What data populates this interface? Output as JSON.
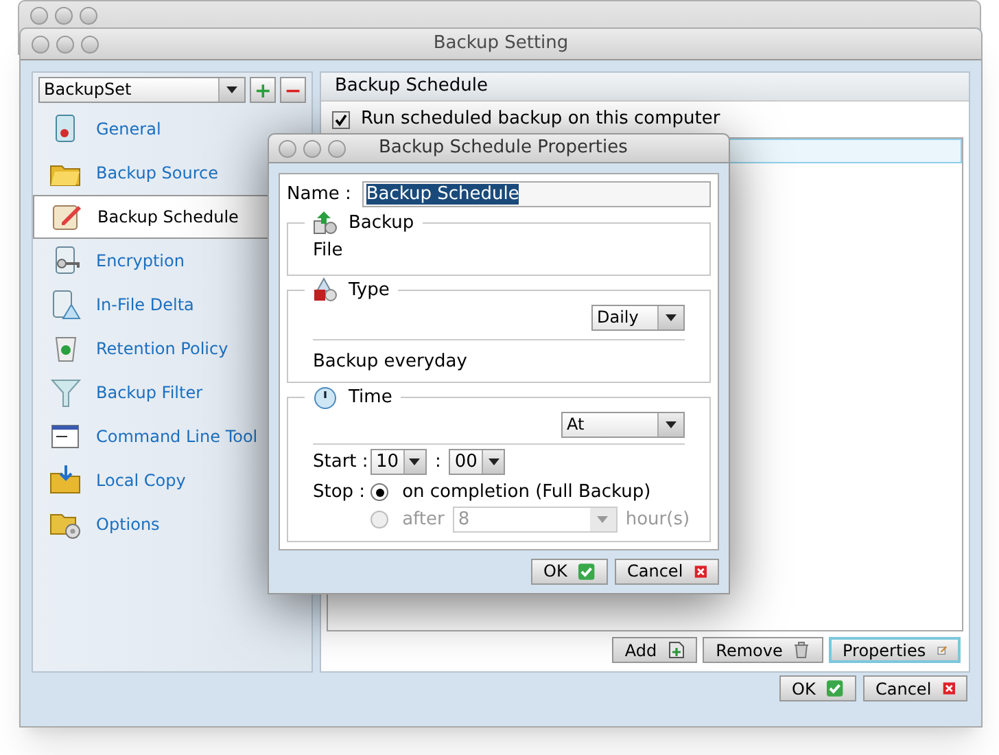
{
  "window": {
    "title": "Backup Setting"
  },
  "sidebar": {
    "backup_set": "BackupSet",
    "add": "+",
    "remove": "−",
    "items": [
      {
        "label": "General",
        "selected": false
      },
      {
        "label": "Backup Source",
        "selected": false
      },
      {
        "label": "Backup Schedule",
        "selected": true
      },
      {
        "label": "Encryption",
        "selected": false
      },
      {
        "label": "In-File Delta",
        "selected": false
      },
      {
        "label": "Retention Policy",
        "selected": false
      },
      {
        "label": "Backup Filter",
        "selected": false
      },
      {
        "label": "Command Line Tool",
        "selected": false
      },
      {
        "label": "Local Copy",
        "selected": false
      },
      {
        "label": "Options",
        "selected": false
      }
    ]
  },
  "main": {
    "header": "Backup Schedule",
    "run_scheduled": {
      "label": "Run scheduled backup on this computer",
      "checked": true
    },
    "schedules": [
      {
        "selected": true
      }
    ],
    "buttons": [
      {
        "label": "Add",
        "focused": false
      },
      {
        "label": "Remove",
        "focused": false
      },
      {
        "label": "Properties",
        "focused": true
      }
    ]
  },
  "footer_buttons": [
    "OK",
    "Cancel"
  ],
  "dialog": {
    "title": "Backup Schedule Properties",
    "name_label": "Name :",
    "name_value": "Backup Schedule",
    "backup": {
      "title": "Backup",
      "value": "File"
    },
    "type": {
      "title": "Type",
      "dropdown": "Daily",
      "description": "Backup everyday"
    },
    "time": {
      "title": "Time",
      "dropdown": "At",
      "start_label": "Start :",
      "hour": "10",
      "separator": ":",
      "minute": "00",
      "stop_label": "Stop :",
      "options": [
        {
          "label": "on completion (Full Backup)",
          "selected": true,
          "disabled": false
        },
        {
          "label": "after",
          "selected": false,
          "disabled": true,
          "value": "8",
          "unit": "hour(s)"
        }
      ]
    },
    "buttons": [
      "OK",
      "Cancel"
    ]
  }
}
